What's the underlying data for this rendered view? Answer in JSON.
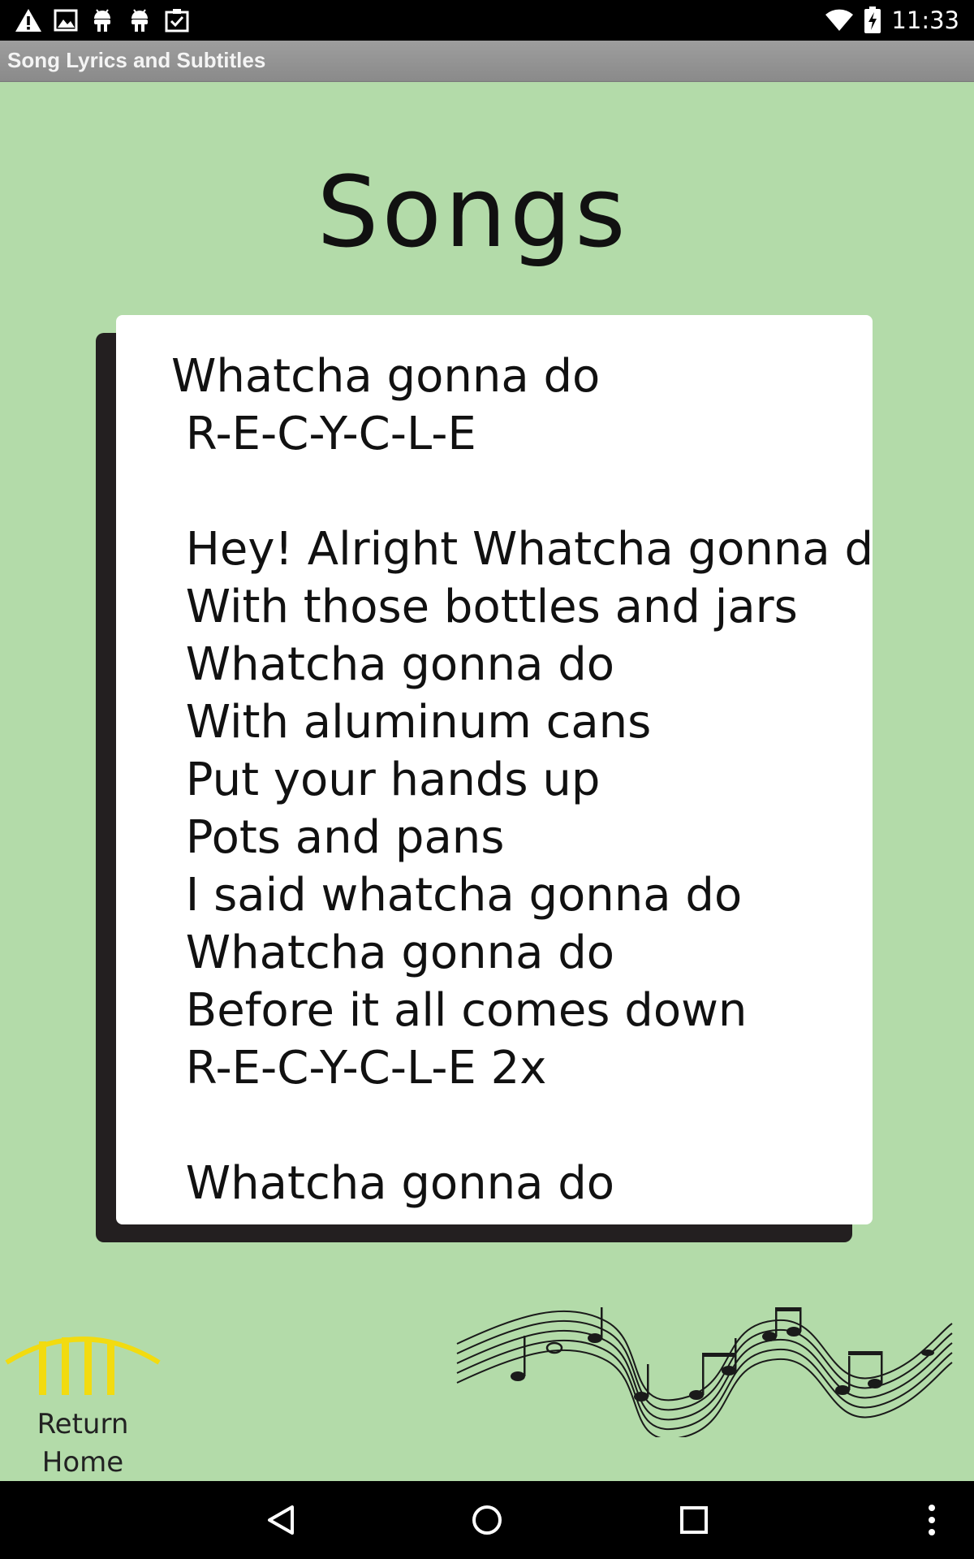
{
  "status_bar": {
    "time": "11:33",
    "left_icons": [
      "warning-icon",
      "image-icon",
      "android-icon",
      "android-icon",
      "clipboard-check-icon"
    ],
    "right_icons": [
      "wifi-icon",
      "battery-charging-icon"
    ]
  },
  "app": {
    "title": "Song Lyrics and Subtitles"
  },
  "page": {
    "heading": "Songs"
  },
  "lyrics": {
    "lines": [
      "Whatcha gonna do",
      " R-E-C-Y-C-L-E",
      "",
      " Hey! Alright Whatcha gonna do",
      " With those bottles and jars",
      " Whatcha gonna do",
      " With aluminum cans",
      " Put your hands up",
      " Pots and pans",
      " I said whatcha gonna do",
      " Whatcha gonna do",
      " Before it all comes down",
      " R-E-C-Y-C-L-E 2x",
      "",
      " Whatcha gonna do"
    ]
  },
  "footer": {
    "return_home_line1": "Return",
    "return_home_line2": "Home",
    "return_icon_color": "#f7e012"
  },
  "nav_bar": {
    "buttons": [
      "back-icon",
      "home-icon",
      "recents-icon",
      "overflow-menu-icon"
    ]
  },
  "colors": {
    "background": "#b3dba9",
    "title_bar": "#959595",
    "card": "#ffffff",
    "card_shadow": "#231f20"
  }
}
